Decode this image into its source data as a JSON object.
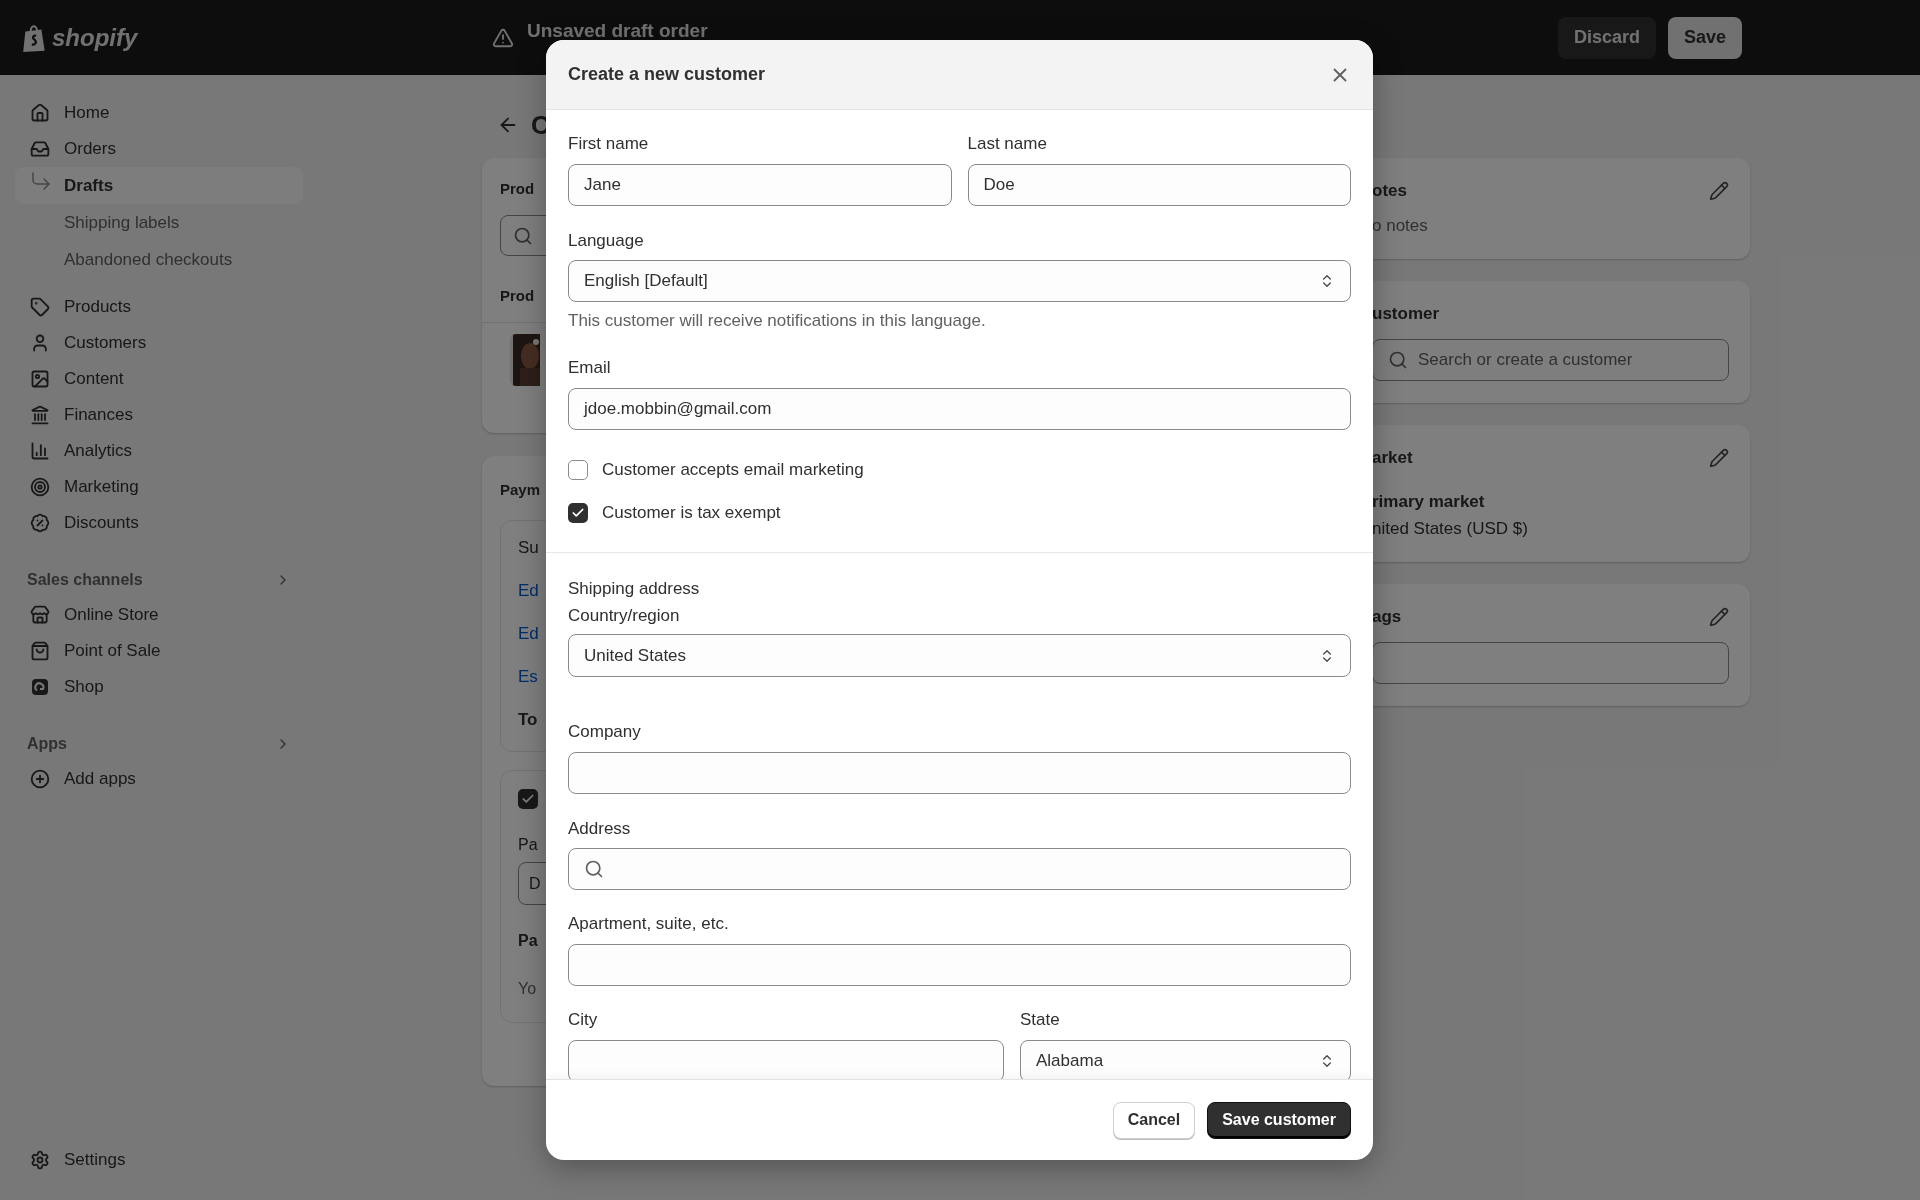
{
  "top_bar": {
    "logo": "shopify",
    "status": "Unsaved draft order",
    "buttons": [
      {
        "label": "Discard",
        "kind": "secondary"
      },
      {
        "label": "Save",
        "kind": "primary"
      }
    ]
  },
  "sidebar": {
    "items": [
      {
        "label": "Home",
        "selected": false
      },
      {
        "label": "Orders",
        "selected": false,
        "children": [
          {
            "label": "Drafts",
            "selected": true
          },
          {
            "label": "Shipping labels",
            "selected": false
          },
          {
            "label": "Abandoned checkouts",
            "selected": false
          }
        ]
      },
      {
        "label": "Products",
        "selected": false
      },
      {
        "label": "Customers",
        "selected": false
      },
      {
        "label": "Content",
        "selected": false
      },
      {
        "label": "Finances",
        "selected": false
      },
      {
        "label": "Analytics",
        "selected": false
      },
      {
        "label": "Marketing",
        "selected": false
      },
      {
        "label": "Discounts",
        "selected": false
      }
    ],
    "sections": [
      {
        "title": "Sales channels",
        "items": [
          {
            "label": "Online Store",
            "selected": false
          },
          {
            "label": "Point of Sale",
            "selected": false
          },
          {
            "label": "Shop",
            "selected": false
          }
        ]
      },
      {
        "title": "Apps",
        "items": [
          {
            "label": "Add apps",
            "selected": false
          }
        ]
      }
    ],
    "footer_item": {
      "label": "Settings",
      "selected": false
    }
  },
  "main": {
    "title": "C",
    "product_card": {
      "heading": "Prod",
      "subheading": "Prod"
    },
    "payment_card": {
      "heading": "Paym",
      "summary_rows": [
        {
          "text": "Su",
          "kind": "plain"
        },
        {
          "text": "Ed",
          "kind": "link"
        },
        {
          "text": "Ed",
          "kind": "link"
        },
        {
          "text": "Es",
          "kind": "link"
        },
        {
          "text": "To",
          "kind": "total"
        }
      ],
      "terms": {
        "checked": true,
        "label": "Pa",
        "field_value": "D",
        "heading": "Pa",
        "text": "Yo"
      }
    },
    "side_cards": [
      {
        "kind": "notes",
        "title": "otes",
        "text": "o notes",
        "editable": true
      },
      {
        "kind": "customer",
        "title": "ustomer",
        "placeholder": "Search or create a customer",
        "editable": false
      },
      {
        "kind": "market",
        "title": "arket",
        "lines": [
          "rimary market",
          "nited States (USD $)"
        ],
        "editable": true
      },
      {
        "kind": "tags",
        "title": "ags",
        "editable": true
      }
    ]
  },
  "dialog": {
    "title": "Create a new customer",
    "first_name": {
      "label": "First name",
      "value": "Jane"
    },
    "last_name": {
      "label": "Last name",
      "value": "Doe"
    },
    "language": {
      "label": "Language",
      "value": "English [Default]",
      "help": "This customer will receive notifications in this language."
    },
    "email": {
      "label": "Email",
      "value": "jdoe.mobbin@gmail.com"
    },
    "checkboxes": [
      {
        "label": "Customer accepts email marketing",
        "checked": false
      },
      {
        "label": "Customer is tax exempt",
        "checked": true
      }
    ],
    "shipping_address": {
      "heading": "Shipping address",
      "country": {
        "label": "Country/region",
        "value": "United States"
      },
      "company": {
        "label": "Company"
      },
      "address": {
        "label": "Address"
      },
      "apartment": {
        "label": "Apartment, suite, etc."
      },
      "city": {
        "label": "City"
      },
      "state": {
        "label": "State",
        "value": "Alabama"
      }
    },
    "buttons": [
      {
        "label": "Cancel",
        "kind": "secondary"
      },
      {
        "label": "Save customer",
        "kind": "primary"
      }
    ]
  }
}
